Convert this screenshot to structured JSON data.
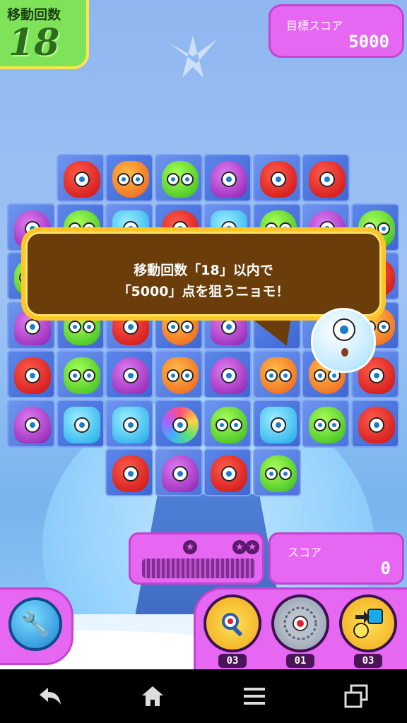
{
  "hud": {
    "moves_label": "移動回数",
    "moves_value": "18",
    "target_label": "目標スコア",
    "target_value": "5000",
    "score_label": "スコア",
    "score_value": "0",
    "star_progress": 0
  },
  "tutorial": {
    "line1": "移動回数「18」以内で",
    "line2": "「5000」点を狙うニョモ！"
  },
  "items": [
    {
      "name": "magic-wand",
      "count": "03"
    },
    {
      "name": "saw-blade",
      "count": "01"
    },
    {
      "name": "shuffle",
      "count": "03"
    }
  ],
  "board": {
    "monsters": [
      [
        "",
        "red",
        "orange",
        "green",
        "purple",
        "red",
        "red",
        ""
      ],
      [
        "purple",
        "green",
        "blue",
        "red",
        "blue",
        "green",
        "purple",
        "green"
      ],
      [
        "green",
        "",
        "",
        "",
        "",
        "",
        "",
        "red"
      ],
      [
        "purple",
        "green",
        "red",
        "orange",
        "purple",
        "",
        "",
        "orange"
      ],
      [
        "red",
        "green",
        "purple",
        "orange",
        "purple",
        "orange",
        "orange",
        "red"
      ],
      [
        "purple",
        "blue",
        "blue",
        "star",
        "green",
        "blue",
        "green",
        "red"
      ],
      [
        "",
        "",
        "red",
        "purple",
        "red",
        "green",
        "",
        ""
      ]
    ]
  },
  "colors": {
    "accent": "#e667f1",
    "moves_bg": "#7fe35a",
    "bubble_bg": "#6b3d0a",
    "bubble_border": "#ffc626"
  }
}
